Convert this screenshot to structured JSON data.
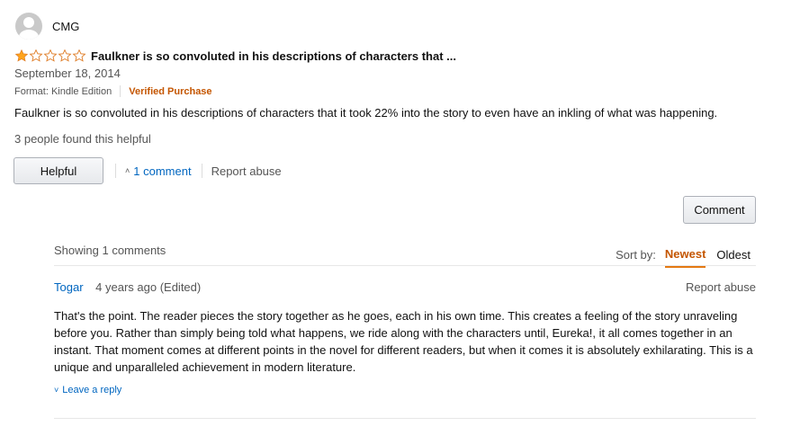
{
  "review": {
    "reviewer_name": "CMG",
    "rating": 1,
    "max_rating": 5,
    "title": "Faulkner is so convoluted in his descriptions of characters that ...",
    "date": "September 18, 2014",
    "format": "Format: Kindle Edition",
    "verified": "Verified Purchase",
    "body": "Faulkner is so convoluted in his descriptions of characters that it took 22% into the story to even have an inkling of what was happening.",
    "helpful_count": "3 people found this helpful",
    "helpful_button": "Helpful",
    "comment_link": "1 comment",
    "report_abuse": "Report abuse",
    "comment_button": "Comment"
  },
  "comments_section": {
    "showing": "Showing 1 comments",
    "sort_label": "Sort by:",
    "sort_options": [
      "Newest",
      "Oldest"
    ],
    "selected_sort": "Newest"
  },
  "comments": [
    {
      "author": "Togar",
      "time": "4 years ago (Edited)",
      "report": "Report abuse",
      "text": "That's the point. The reader pieces the story together as he goes, each in his own time. This creates a feeling of the story unraveling before you. Rather than simply being told what happens, we ride along with the characters until, Eureka!, it all comes together in an instant. That moment comes at different points in the novel for different readers, but when it comes it is absolutely exhilarating. This is a unique and unparalleled achievement in modern literature.",
      "reply": "Leave a reply"
    }
  ],
  "colors": {
    "star": "#ffa41c",
    "link": "#0066c0",
    "verified": "#c45500",
    "sort_underline": "#e47911"
  }
}
